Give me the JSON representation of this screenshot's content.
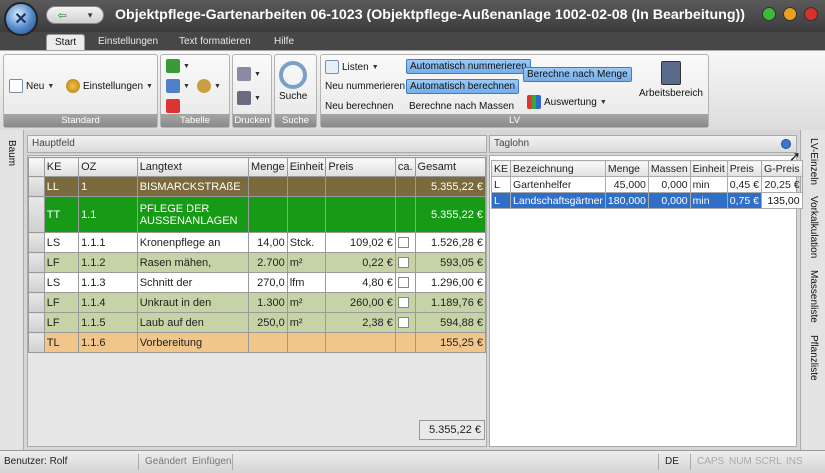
{
  "window": {
    "title": "Objektpflege-Gartenarbeiten 06-1023 (Objektpflege-Außenanlage 1002-02-08 (In Bearbeitung))"
  },
  "tabs": [
    "Start",
    "Einstellungen",
    "Text formatieren",
    "Hilfe"
  ],
  "ribbon": {
    "standard": {
      "label": "Standard",
      "neu": "Neu",
      "einstellungen": "Einstellungen"
    },
    "tabelle": {
      "label": "Tabelle"
    },
    "drucken": {
      "label": "Drucken"
    },
    "suche": {
      "label": "Suche",
      "button": "Suche"
    },
    "lv": {
      "label": "LV",
      "listen": "Listen",
      "neu_nummerieren": "Neu nummerieren",
      "neu_berechnen": "Neu berechnen",
      "auto_nummerieren": "Automatisch nummerieren",
      "auto_berechnen": "Automatisch berechnen",
      "berechne_menge": "Berechne nach Menge",
      "berechne_massen": "Berechne nach Massen",
      "auswertung": "Auswertung",
      "arbeitsbereich": "Arbeitsbereich"
    }
  },
  "left_sidebar": {
    "label": "Baum"
  },
  "right_sidebar": {
    "items": [
      "LV-Einzeln",
      "Vorkalkulation",
      "Massenliste",
      "Pflanzliste"
    ]
  },
  "hauptfeld": {
    "title": "Hauptfeld",
    "columns": [
      "KE",
      "OZ",
      "Langtext",
      "Menge",
      "Einheit",
      "Preis",
      "ca.",
      "Gesamt"
    ],
    "rows": [
      {
        "ke": "LL",
        "oz": "1",
        "text": "BISMARCKSTRAßE",
        "menge": "",
        "einheit": "",
        "preis": "",
        "ca": false,
        "gesamt": "5.355,22 €",
        "style": "brown"
      },
      {
        "ke": "TT",
        "oz": "1.1",
        "text": "PFLEGE DER",
        "text2": "AUSSENANLAGEN",
        "menge": "",
        "einheit": "",
        "preis": "",
        "ca": false,
        "gesamt": "5.355,22 €",
        "style": "green"
      },
      {
        "ke": "LS",
        "oz": "1.1.1",
        "text": "Kronenpflege an",
        "menge": "14,00",
        "einheit": "Stck.",
        "preis": "109,02 €",
        "ca": true,
        "gesamt": "1.526,28 €",
        "style": "white"
      },
      {
        "ke": "LF",
        "oz": "1.1.2",
        "text": "Rasen mähen,",
        "menge": "2.700",
        "einheit": "m²",
        "preis": "0,22 €",
        "ca": true,
        "gesamt": "593,05 €",
        "style": "olive"
      },
      {
        "ke": "LS",
        "oz": "1.1.3",
        "text": "Schnitt der",
        "menge": "270,0",
        "einheit": "lfm",
        "preis": "4,80 €",
        "ca": true,
        "gesamt": "1.296,00 €",
        "style": "white"
      },
      {
        "ke": "LF",
        "oz": "1.1.4",
        "text": "Unkraut in den",
        "menge": "1.300",
        "einheit": "m²",
        "preis": "260,00 €",
        "ca": true,
        "gesamt": "1.189,76 €",
        "style": "olive"
      },
      {
        "ke": "LF",
        "oz": "1.1.5",
        "text": "Laub auf den",
        "menge": "250,0",
        "einheit": "m²",
        "preis": "2,38 €",
        "ca": true,
        "gesamt": "594,88 €",
        "style": "olive"
      },
      {
        "ke": "TL",
        "oz": "1.1.6",
        "text": "Vorbereitung",
        "menge": "",
        "einheit": "",
        "preis": "",
        "ca": false,
        "gesamt": "155,25 €",
        "style": "orange"
      }
    ],
    "total": "5.355,22 €"
  },
  "taglohn": {
    "title": "Taglohn",
    "columns": [
      "KE",
      "Bezeichnung",
      "Menge",
      "Massen",
      "Einheit",
      "Preis",
      "G-Preis"
    ],
    "rows": [
      {
        "ke": "L",
        "bez": "Gartenhelfer",
        "menge": "45,000",
        "massen": "0,000",
        "einheit": "min",
        "preis": "0,45 €",
        "gpreis": "20,25 €",
        "selected": false
      },
      {
        "ke": "L",
        "bez": "Landschaftsgärtner",
        "menge": "180,000",
        "massen": "0,000",
        "einheit": "min",
        "preis": "0,75 €",
        "gpreis": "135,00",
        "selected": true
      }
    ]
  },
  "status": {
    "user": "Benutzer: Rolf",
    "geaendert": "Geändert",
    "einfuegen": "Einfügen",
    "lang": "DE",
    "caps": "CAPS",
    "num": "NUM",
    "scrl": "SCRL",
    "ins": "INS"
  }
}
